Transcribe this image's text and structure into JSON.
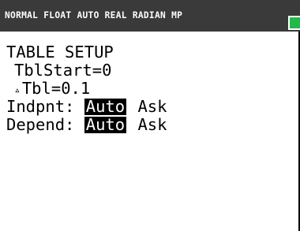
{
  "status_bar": {
    "text": "NORMAL FLOAT AUTO REAL RADIAN MP",
    "battery_icon": "battery-icon",
    "battery_color": "#22b84a"
  },
  "table_setup": {
    "title": "TABLE SETUP",
    "tbl_start": "TblStart=0",
    "delta_symbol": "▵",
    "delta_tbl": "Tbl=0.1",
    "indpnt": {
      "label": "Indpnt:",
      "options": [
        "Auto",
        "Ask"
      ],
      "selected": "Auto"
    },
    "depend": {
      "label": "Depend:",
      "options": [
        "Auto",
        "Ask"
      ],
      "selected": "Auto"
    }
  }
}
